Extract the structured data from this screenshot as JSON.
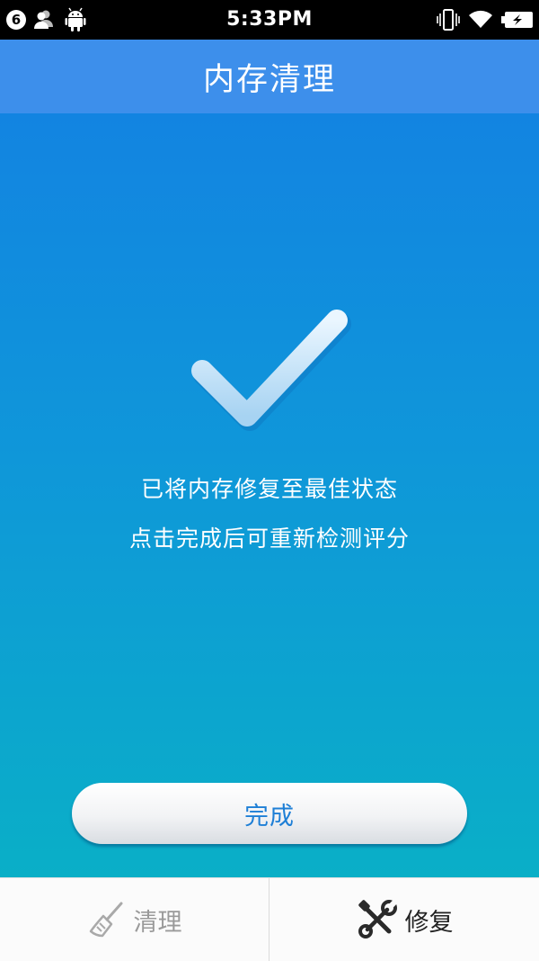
{
  "status_bar": {
    "notification_count": "6",
    "time": "5:33PM",
    "icons": [
      "contacts-icon",
      "android-icon",
      "vibrate-icon",
      "wifi-icon",
      "battery-charging-icon"
    ]
  },
  "header": {
    "title": "内存清理"
  },
  "result": {
    "icon": "checkmark-icon",
    "line1": "已将内存修复至最佳状态",
    "line2": "点击完成后可重新检测评分"
  },
  "actions": {
    "done_label": "完成"
  },
  "bottom_nav": {
    "tabs": [
      {
        "label": "清理",
        "icon": "broom-icon",
        "active": false
      },
      {
        "label": "修复",
        "icon": "tools-icon",
        "active": true
      }
    ]
  },
  "colors": {
    "title_bar": "#3d8feb",
    "gradient_top": "#1380e3",
    "gradient_bottom": "#0aafc7",
    "button_text": "#1e7fd6"
  }
}
